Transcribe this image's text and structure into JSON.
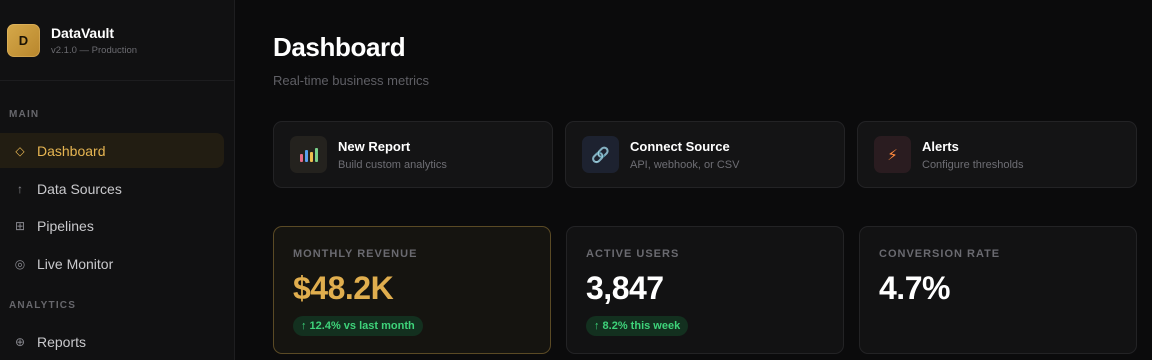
{
  "brand": {
    "logo_letter": "D",
    "name": "DataVault",
    "version": "v2.1.0 — Production"
  },
  "sidebar": {
    "sections": [
      {
        "label": "MAIN"
      },
      {
        "label": "ANALYTICS"
      }
    ],
    "items": [
      {
        "label": "Dashboard",
        "icon": "diamond-icon",
        "glyph": "◇",
        "active": true
      },
      {
        "label": "Data Sources",
        "icon": "arrow-up-icon",
        "glyph": "↑",
        "active": false
      },
      {
        "label": "Pipelines",
        "icon": "grid-icon",
        "glyph": "⊞",
        "active": false
      },
      {
        "label": "Live Monitor",
        "icon": "target-icon",
        "glyph": "◎",
        "active": false
      },
      {
        "label": "Reports",
        "icon": "globe-icon",
        "glyph": "⊕",
        "active": false
      }
    ]
  },
  "header": {
    "title": "Dashboard",
    "subtitle": "Real-time business metrics"
  },
  "actions": [
    {
      "title": "New Report",
      "desc": "Build custom analytics",
      "icon": "bar-chart-icon"
    },
    {
      "title": "Connect Source",
      "desc": "API, webhook, or CSV",
      "icon": "link-icon",
      "glyph": "🔗"
    },
    {
      "title": "Alerts",
      "desc": "Configure thresholds",
      "icon": "lightning-icon",
      "glyph": "⚡"
    }
  ],
  "metrics": [
    {
      "label": "MONTHLY REVENUE",
      "value": "$48.2K",
      "delta": "↑ 12.4% vs last month"
    },
    {
      "label": "ACTIVE USERS",
      "value": "3,847",
      "delta": "↑ 8.2% this week"
    },
    {
      "label": "CONVERSION RATE",
      "value": "4.7%"
    }
  ],
  "colors": {
    "accent": "#e0ae4e",
    "background": "#0b0b0c",
    "sidebar": "#111112",
    "positive": "#3ed37a"
  }
}
